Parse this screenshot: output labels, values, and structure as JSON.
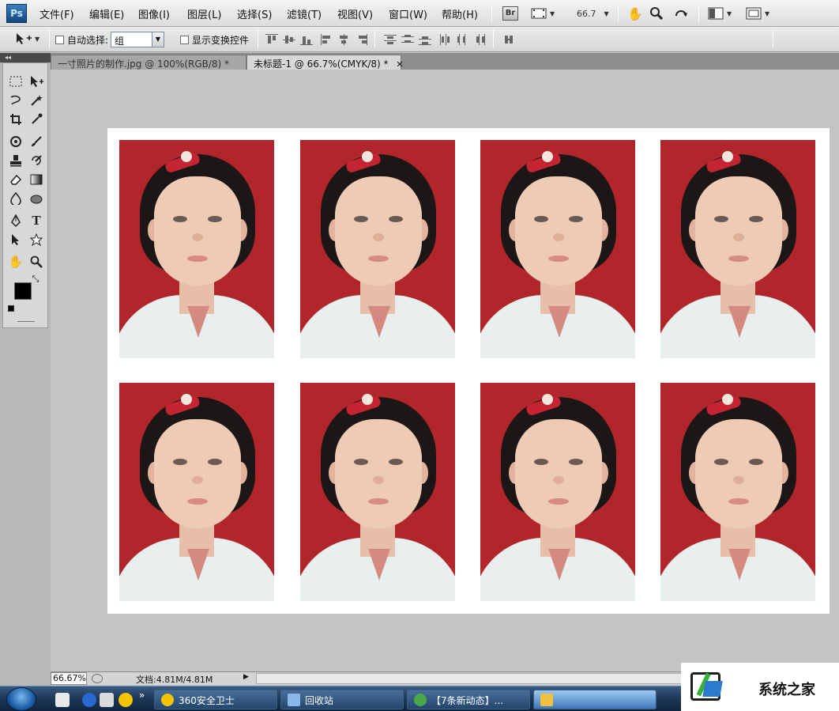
{
  "app": {
    "logo": "Ps"
  },
  "menu": [
    "文件(F)",
    "编辑(E)",
    "图像(I)",
    "图层(L)",
    "选择(S)",
    "滤镜(T)",
    "视图(V)",
    "窗口(W)",
    "帮助(H)"
  ],
  "menubar_tools": {
    "bridge_label": "Br",
    "zoom": "66.7"
  },
  "options": {
    "auto_select_label": "自动选择:",
    "auto_select_value": "组",
    "show_transform_label": "显示变换控件"
  },
  "tabs": [
    {
      "label": "一寸照片的制作.jpg @ 100%(RGB/8) *",
      "active": false
    },
    {
      "label": "未标题-1 @ 66.7%(CMYK/8) *",
      "active": true
    }
  ],
  "status": {
    "zoom": "66.67%",
    "doc_size": "文档:4.81M/4.81M"
  },
  "taskbar": {
    "buttons": [
      {
        "label": "360安全卫士",
        "color": "#f5c400"
      },
      {
        "label": "回收站",
        "color": "#8ab8e8"
      },
      {
        "label": "【7条新动态】...",
        "color": "#4aa84a"
      },
      {
        "label": "",
        "color": "#f0c040"
      }
    ]
  },
  "watermark": {
    "text": "系统之家"
  },
  "colors": {
    "photo_bg": "#b1262a",
    "foreground": "#000000",
    "background": "#ffffff"
  }
}
